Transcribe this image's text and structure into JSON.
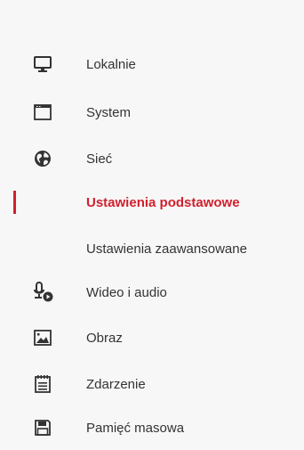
{
  "sidebar": {
    "items": [
      {
        "label": "Lokalnie",
        "icon": "monitor-icon"
      },
      {
        "label": "System",
        "icon": "window-icon"
      },
      {
        "label": "Sieć",
        "icon": "globe-icon"
      },
      {
        "label": "Ustawienia podstawowe",
        "icon": "",
        "sub": true,
        "active": true
      },
      {
        "label": "Ustawienia zaawansowane",
        "icon": "",
        "sub": true
      },
      {
        "label": "Wideo i audio",
        "icon": "video-audio-icon"
      },
      {
        "label": "Obraz",
        "icon": "image-icon"
      },
      {
        "label": "Zdarzenie",
        "icon": "calendar-list-icon"
      },
      {
        "label": "Pamięć masowa",
        "icon": "storage-icon"
      }
    ]
  },
  "colors": {
    "active": "#d0202e",
    "text": "#333333",
    "background": "#f7f7f7"
  }
}
